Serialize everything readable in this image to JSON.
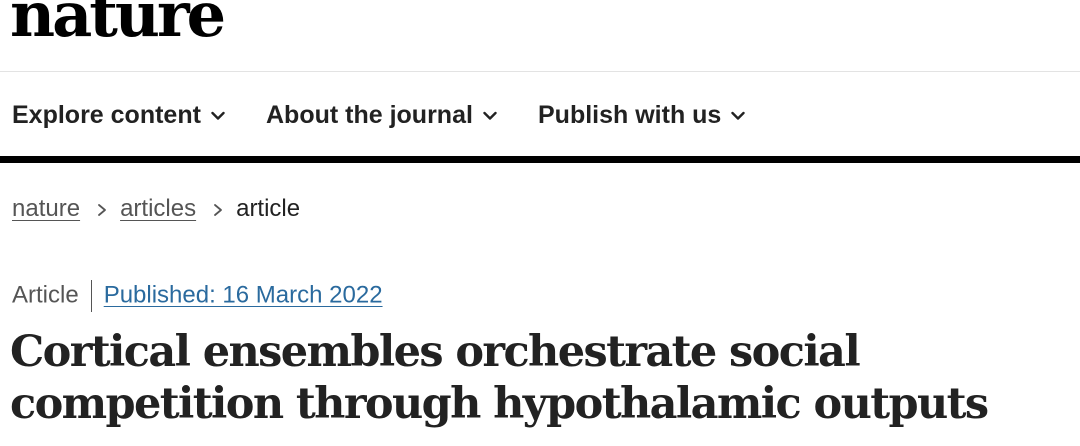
{
  "header": {
    "logo": "nature"
  },
  "nav": {
    "items": [
      {
        "label": "Explore content"
      },
      {
        "label": "About the journal"
      },
      {
        "label": "Publish with us"
      }
    ]
  },
  "breadcrumb": {
    "items": [
      {
        "label": "nature"
      },
      {
        "label": "articles"
      },
      {
        "label": "article"
      }
    ]
  },
  "article": {
    "type": "Article",
    "published": "Published: 16 March 2022",
    "title": "Cortical ensembles orchestrate social competition through hypothalamic outputs"
  },
  "colors": {
    "link": "#2a6a9e",
    "text": "#222222",
    "muted": "#555555",
    "nav_rule": "#000000"
  }
}
